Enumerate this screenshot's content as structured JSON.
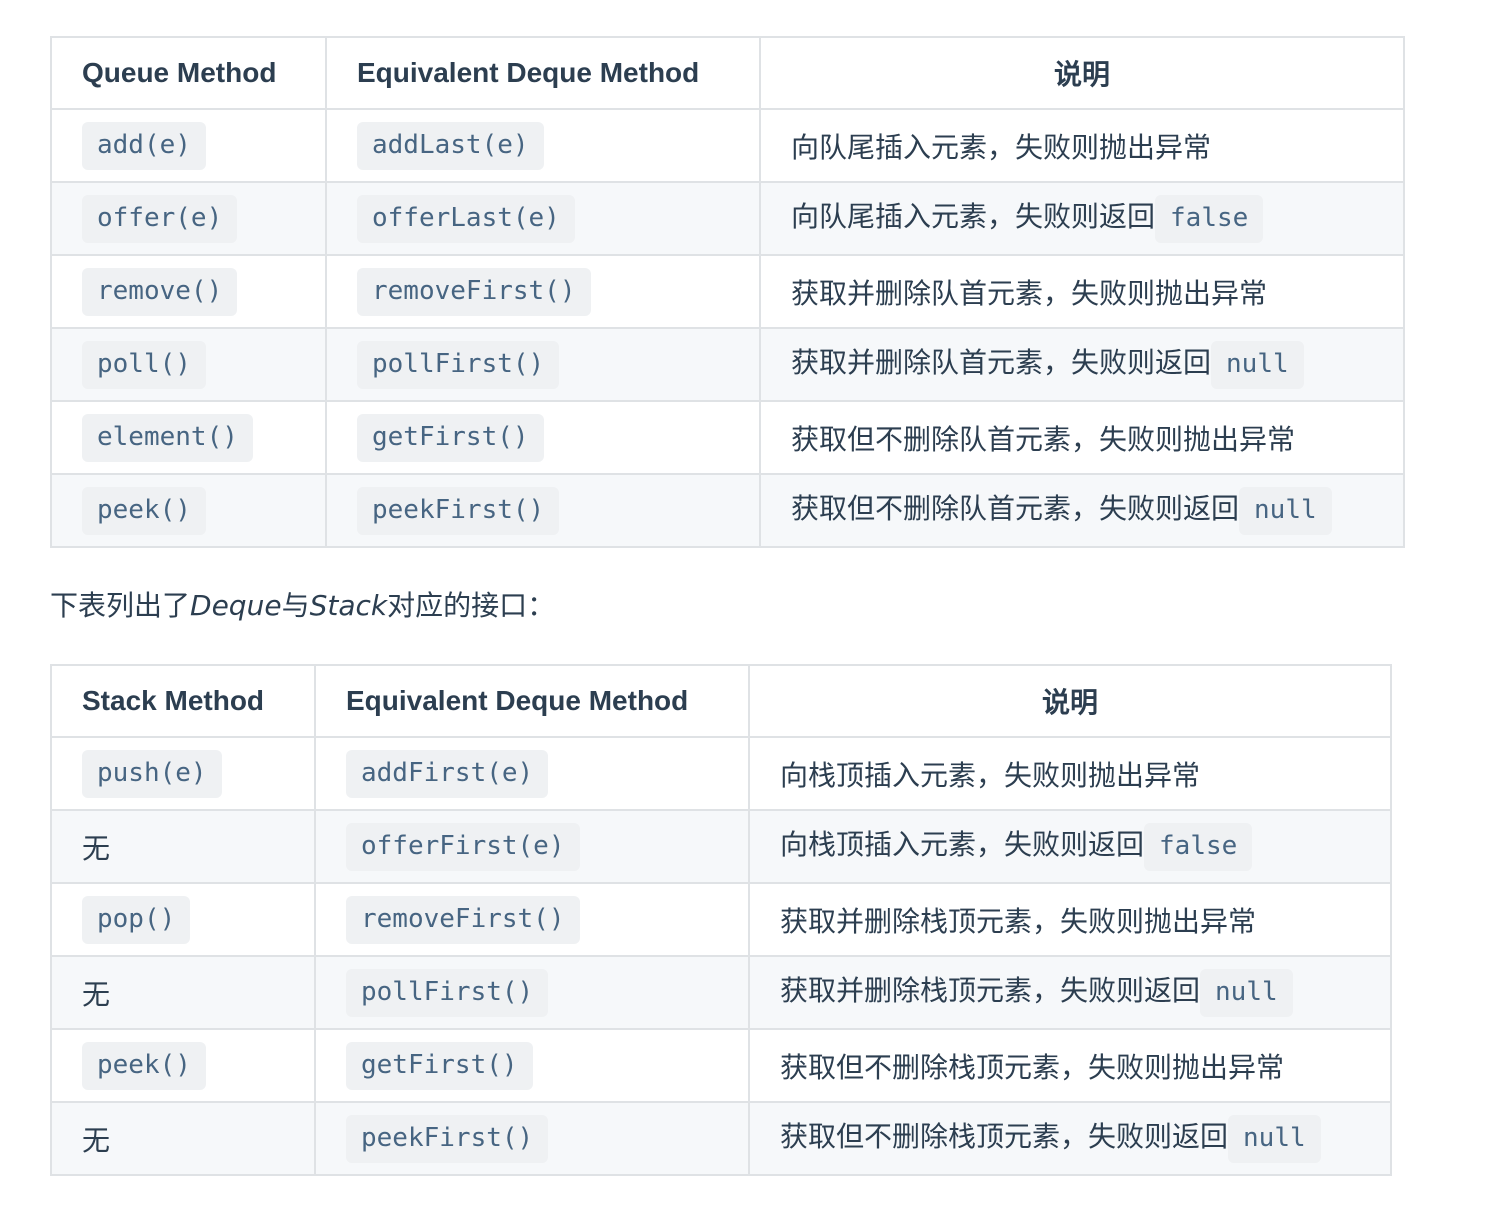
{
  "queue_table": {
    "headers": [
      "Queue Method",
      "Equivalent Deque Method",
      "说明"
    ],
    "rows": [
      {
        "method": "add(e)",
        "deque": "addLast(e)",
        "desc": "向队尾插入元素，失败则抛出异常",
        "desc_code": ""
      },
      {
        "method": "offer(e)",
        "deque": "offerLast(e)",
        "desc": "向队尾插入元素，失败则返回",
        "desc_code": "false"
      },
      {
        "method": "remove()",
        "deque": "removeFirst()",
        "desc": "获取并删除队首元素，失败则抛出异常",
        "desc_code": ""
      },
      {
        "method": "poll()",
        "deque": "pollFirst()",
        "desc": "获取并删除队首元素，失败则返回",
        "desc_code": "null"
      },
      {
        "method": "element()",
        "deque": "getFirst()",
        "desc": "获取但不删除队首元素，失败则抛出异常",
        "desc_code": ""
      },
      {
        "method": "peek()",
        "deque": "peekFirst()",
        "desc": "获取但不删除队首元素，失败则返回",
        "desc_code": "null"
      }
    ]
  },
  "intro": {
    "before": "下表列出了",
    "term1": "Deque",
    "middle": "与",
    "term2": "Stack",
    "after": "对应的接口："
  },
  "stack_table": {
    "headers": [
      "Stack Method",
      "Equivalent Deque Method",
      "说明"
    ],
    "rows": [
      {
        "method": "push(e)",
        "method_is_code": true,
        "deque": "addFirst(e)",
        "desc": "向栈顶插入元素，失败则抛出异常",
        "desc_code": ""
      },
      {
        "method": "无",
        "method_is_code": false,
        "deque": "offerFirst(e)",
        "desc": "向栈顶插入元素，失败则返回",
        "desc_code": "false"
      },
      {
        "method": "pop()",
        "method_is_code": true,
        "deque": "removeFirst()",
        "desc": "获取并删除栈顶元素，失败则抛出异常",
        "desc_code": ""
      },
      {
        "method": "无",
        "method_is_code": false,
        "deque": "pollFirst()",
        "desc": "获取并删除栈顶元素，失败则返回",
        "desc_code": "null"
      },
      {
        "method": "peek()",
        "method_is_code": true,
        "deque": "getFirst()",
        "desc": "获取但不删除栈顶元素，失败则抛出异常",
        "desc_code": ""
      },
      {
        "method": "无",
        "method_is_code": false,
        "deque": "peekFirst()",
        "desc": "获取但不删除栈顶元素，失败则返回",
        "desc_code": "null"
      }
    ]
  }
}
